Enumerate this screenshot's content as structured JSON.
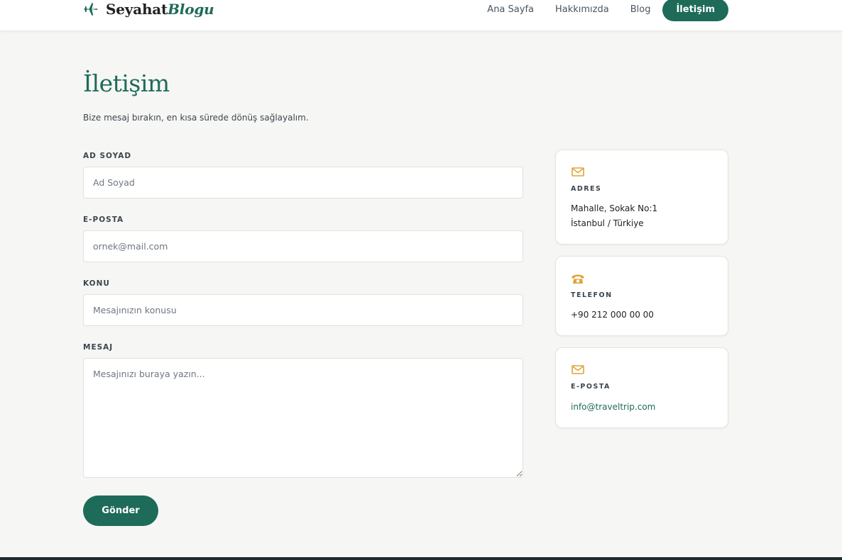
{
  "brand": {
    "name_main": "Seyahat",
    "name_accent": "Blogu",
    "icon": "plane-icon",
    "color": "#1e6b5a"
  },
  "nav": {
    "items": [
      {
        "label": "Ana Sayfa"
      },
      {
        "label": "Hakkımızda"
      },
      {
        "label": "Blog"
      },
      {
        "label": "İletişim",
        "active": true
      }
    ]
  },
  "page": {
    "title": "İletişim",
    "subtitle": "Bize mesaj bırakın, en kısa sürede dönüş sağlayalım."
  },
  "form": {
    "name": {
      "label": "AD SOYAD",
      "placeholder": "Ad Soyad",
      "value": ""
    },
    "email": {
      "label": "E-POSTA",
      "placeholder": "ornek@mail.com",
      "value": ""
    },
    "subject": {
      "label": "KONU",
      "placeholder": "Mesajınızın konusu",
      "value": ""
    },
    "message": {
      "label": "MESAJ",
      "placeholder": "Mesajınızı buraya yazın...",
      "value": ""
    },
    "submit_label": "Gönder"
  },
  "contact": {
    "address": {
      "icon": "envelope-icon",
      "label": "ADRES",
      "line1": "Mahalle, Sokak No:1",
      "line2": "İstanbul / Türkiye"
    },
    "phone": {
      "icon": "telephone-icon",
      "label": "TELEFON",
      "value": "+90 212 000 00 00"
    },
    "email": {
      "icon": "envelope-icon",
      "label": "E-POSTA",
      "value": "info@traveltrip.com"
    }
  },
  "colors": {
    "accent": "#1e6b5a",
    "icon_gold": "#e0a437",
    "background": "#f6f6f4"
  }
}
